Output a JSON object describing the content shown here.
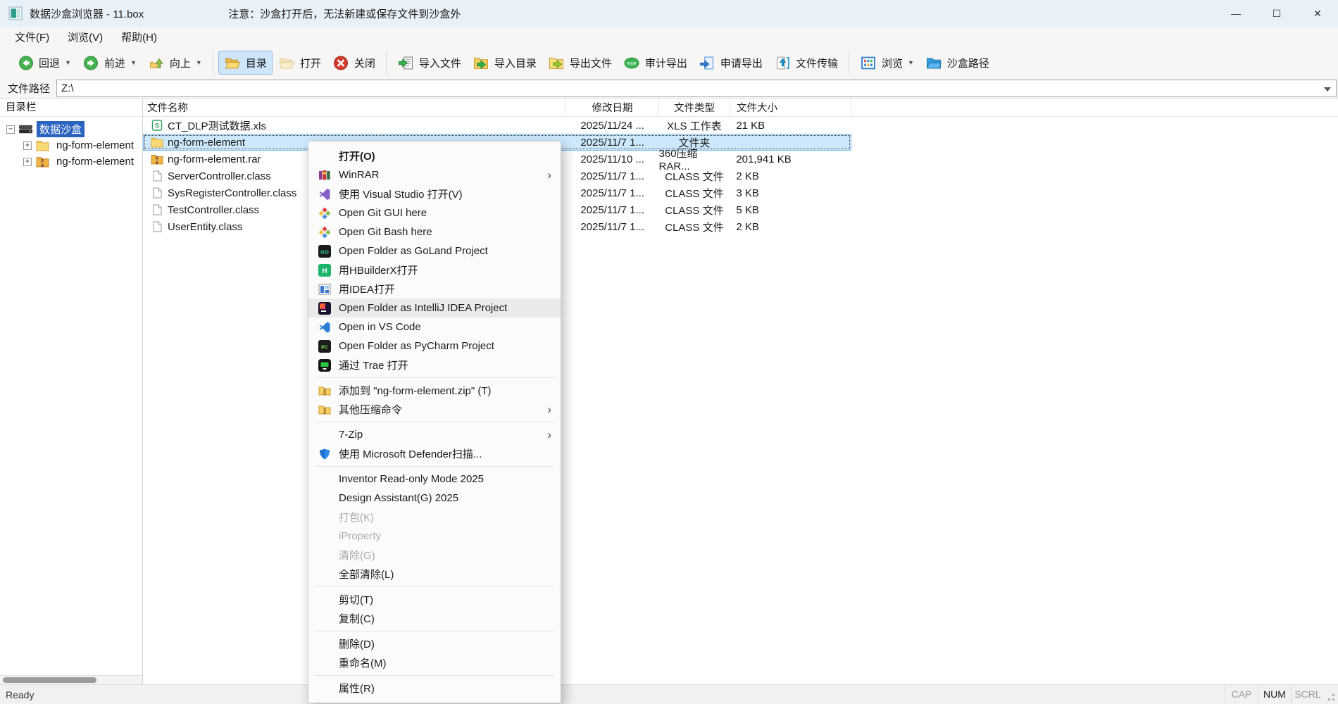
{
  "window": {
    "title": "数据沙盒浏览器 - 11.box",
    "notice": "注意：沙盒打开后，无法新建或保存文件到沙盒外",
    "controls": [
      {
        "name": "minimize",
        "glyph": "—"
      },
      {
        "name": "maximize",
        "glyph": "☐"
      },
      {
        "name": "close",
        "glyph": "✕"
      }
    ]
  },
  "menu_bar": {
    "items": [
      "文件(F)",
      "浏览(V)",
      "帮助(H)"
    ]
  },
  "toolbar": {
    "items": [
      {
        "label": "回退",
        "icon": "back",
        "dropdown": true
      },
      {
        "label": "前进",
        "icon": "forward",
        "dropdown": true
      },
      {
        "label": "向上",
        "icon": "up",
        "dropdown": true
      },
      {
        "type": "separator"
      },
      {
        "label": "目录",
        "icon": "directory",
        "active": true
      },
      {
        "label": "打开",
        "icon": "open-folder"
      },
      {
        "label": "关闭",
        "icon": "close-red"
      },
      {
        "type": "separator"
      },
      {
        "label": "导入文件",
        "icon": "import-file"
      },
      {
        "label": "导入目录",
        "icon": "import-dir"
      },
      {
        "label": "导出文件",
        "icon": "export-file"
      },
      {
        "label": "审计导出",
        "icon": "audit-export"
      },
      {
        "label": "申请导出",
        "icon": "apply-export"
      },
      {
        "label": "文件传输",
        "icon": "file-transfer"
      },
      {
        "type": "separator"
      },
      {
        "label": "浏览",
        "icon": "browse",
        "dropdown": true
      },
      {
        "label": "沙盒路径",
        "icon": "sandbox-path"
      }
    ]
  },
  "address_bar": {
    "label": "文件路径",
    "value": "Z:\\"
  },
  "sidebar": {
    "header": "目录栏",
    "tree": [
      {
        "label": "数据沙盒",
        "icon": "drive",
        "level": 0,
        "expanded": true,
        "selected": true
      },
      {
        "label": "ng-form-element",
        "icon": "folder",
        "level": 1,
        "expanded": false,
        "selected": false
      },
      {
        "label": "ng-form-element",
        "icon": "rar",
        "level": 1,
        "expanded": false,
        "selected": false
      }
    ]
  },
  "file_list": {
    "columns": [
      "文件名称",
      "修改日期",
      "文件类型",
      "文件大小"
    ],
    "rows": [
      {
        "name": "CT_DLP测试数据.xls",
        "date": "2025/11/24 ...",
        "type": "XLS 工作表",
        "size": "21 KB",
        "icon": "xls",
        "selected": false
      },
      {
        "name": "ng-form-element",
        "date": "2025/11/7 1...",
        "type": "文件夹",
        "size": "",
        "icon": "folder",
        "selected": true
      },
      {
        "name": "ng-form-element.rar",
        "date": "2025/11/10 ...",
        "type": "360压缩 RAR...",
        "size": "201,941 KB",
        "icon": "rar",
        "selected": false
      },
      {
        "name": "ServerController.class",
        "date": "2025/11/7 1...",
        "type": "CLASS 文件",
        "size": "2 KB",
        "icon": "classfile",
        "selected": false
      },
      {
        "name": "SysRegisterController.class",
        "date": "2025/11/7 1...",
        "type": "CLASS 文件",
        "size": "3 KB",
        "icon": "classfile",
        "selected": false
      },
      {
        "name": "TestController.class",
        "date": "2025/11/7 1...",
        "type": "CLASS 文件",
        "size": "5 KB",
        "icon": "classfile",
        "selected": false
      },
      {
        "name": "UserEntity.class",
        "date": "2025/11/7 1...",
        "type": "CLASS 文件",
        "size": "2 KB",
        "icon": "classfile",
        "selected": false
      }
    ]
  },
  "context_menu": {
    "items": [
      {
        "label": "打开(O)",
        "bold": true
      },
      {
        "label": "WinRAR",
        "icon": "winrar",
        "submenu": true
      },
      {
        "label": "使用 Visual Studio 打开(V)",
        "icon": "visual-studio"
      },
      {
        "label": "Open Git GUI here",
        "icon": "git"
      },
      {
        "label": "Open Git Bash here",
        "icon": "git"
      },
      {
        "label": "Open Folder as GoLand Project",
        "icon": "goland"
      },
      {
        "label": "用HBuilderX打开",
        "icon": "hbuilderx"
      },
      {
        "label": "用IDEA打开",
        "icon": "idea-window"
      },
      {
        "label": "Open Folder as IntelliJ IDEA Project",
        "icon": "intellij",
        "highlighted": true
      },
      {
        "label": "Open in VS Code",
        "icon": "vscode"
      },
      {
        "label": "Open Folder as PyCharm Project",
        "icon": "pycharm"
      },
      {
        "label": "通过 Trae 打开",
        "icon": "trae"
      },
      {
        "separator": true
      },
      {
        "label": "添加到 \"ng-form-element.zip\" (T)",
        "icon": "zip"
      },
      {
        "label": "其他压缩命令",
        "icon": "zip",
        "submenu": true
      },
      {
        "separator": true
      },
      {
        "label": "7-Zip",
        "submenu": true
      },
      {
        "label": "使用 Microsoft Defender扫描...",
        "icon": "defender"
      },
      {
        "separator": true
      },
      {
        "label": "Inventor Read-only Mode 2025"
      },
      {
        "label": "Design Assistant(G) 2025"
      },
      {
        "label": "打包(K)",
        "disabled": true
      },
      {
        "label": "iProperty",
        "disabled": true
      },
      {
        "label": "清除(G)",
        "disabled": true
      },
      {
        "label": "全部清除(L)"
      },
      {
        "separator": true
      },
      {
        "label": "剪切(T)"
      },
      {
        "label": "复制(C)"
      },
      {
        "separator": true
      },
      {
        "label": "删除(D)"
      },
      {
        "label": "重命名(M)"
      },
      {
        "separator": true
      },
      {
        "label": "属性(R)"
      }
    ]
  },
  "status_bar": {
    "left": "Ready",
    "indicators": [
      {
        "label": "CAP",
        "active": false
      },
      {
        "label": "NUM",
        "active": true
      },
      {
        "label": "SCRL",
        "active": false
      }
    ]
  }
}
